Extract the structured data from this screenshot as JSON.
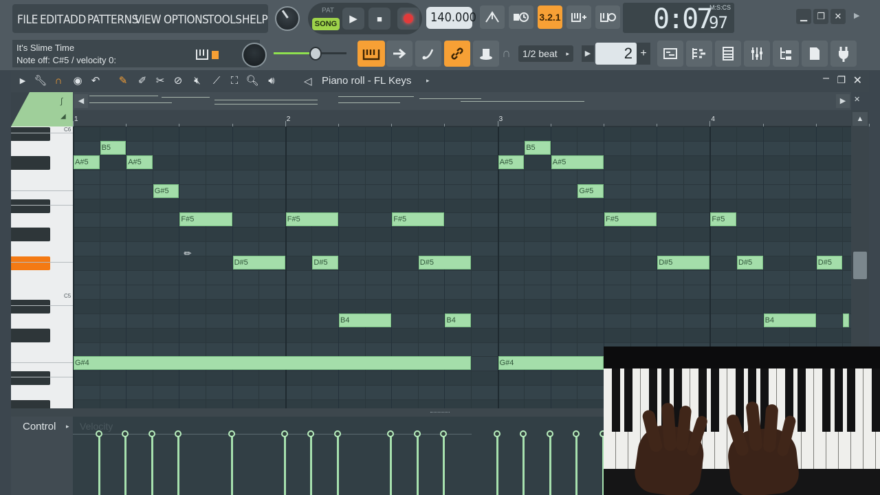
{
  "menu": {
    "items": [
      "FILE",
      "EDIT",
      "ADD",
      "PATTERNS",
      "VIEW",
      "OPTIONS",
      "TOOLS",
      "HELP"
    ]
  },
  "transport": {
    "pat_label": "PAT",
    "song_label": "SONG",
    "play_icon": "▶",
    "stop_icon": "■",
    "tempo": "140.000"
  },
  "time": {
    "main": "0:07",
    "cs": "97",
    "format": "M:S:CS"
  },
  "hint": {
    "title": "It's Slime Time",
    "text": "Note off: C#5 / velocity 0:"
  },
  "toolbar2": {
    "snap": "1/2 beat",
    "pattern_number": "2",
    "plus": "+"
  },
  "piano_roll": {
    "title": "Piano roll - FL Keys",
    "bar_numbers": [
      "1",
      "2",
      "3",
      "4"
    ],
    "octave_labels": [
      "C6",
      "C5"
    ],
    "control_label": "Control",
    "velocity_label": "Velocity"
  },
  "notes": [
    {
      "label": "B5",
      "row": 1,
      "start": 1,
      "len": 1
    },
    {
      "label": "A#5",
      "row": 2,
      "start": 0,
      "len": 1
    },
    {
      "label": "A#5",
      "row": 2,
      "start": 2,
      "len": 1
    },
    {
      "label": "G#5",
      "row": 4,
      "start": 3,
      "len": 1
    },
    {
      "label": "F#5",
      "row": 6,
      "start": 4,
      "len": 2
    },
    {
      "label": "F#5",
      "row": 6,
      "start": 8,
      "len": 2
    },
    {
      "label": "F#5",
      "row": 6,
      "start": 12,
      "len": 2
    },
    {
      "label": "D#5",
      "row": 9,
      "start": 6,
      "len": 2
    },
    {
      "label": "D#5",
      "row": 9,
      "start": 9,
      "len": 1
    },
    {
      "label": "D#5",
      "row": 9,
      "start": 13,
      "len": 2
    },
    {
      "label": "B4",
      "row": 13,
      "start": 10,
      "len": 2
    },
    {
      "label": "B4",
      "row": 13,
      "start": 14,
      "len": 1
    },
    {
      "label": "G#4",
      "row": 16,
      "start": 0,
      "len": 15
    },
    {
      "label": "B5",
      "row": 1,
      "start": 17,
      "len": 1
    },
    {
      "label": "A#5",
      "row": 2,
      "start": 16,
      "len": 1
    },
    {
      "label": "A#5",
      "row": 2,
      "start": 18,
      "len": 2
    },
    {
      "label": "G#5",
      "row": 4,
      "start": 19,
      "len": 1
    },
    {
      "label": "F#5",
      "row": 6,
      "start": 20,
      "len": 2
    },
    {
      "label": "F#5",
      "row": 6,
      "start": 24,
      "len": 1
    },
    {
      "label": "D#5",
      "row": 9,
      "start": 22,
      "len": 2
    },
    {
      "label": "D#5",
      "row": 9,
      "start": 25,
      "len": 1
    },
    {
      "label": "D#5",
      "row": 9,
      "start": 28,
      "len": 1
    },
    {
      "label": "B4",
      "row": 13,
      "start": 26,
      "len": 2
    },
    {
      "label": "",
      "row": 13,
      "start": 29,
      "len": 0.25
    },
    {
      "label": "G#4",
      "row": 16,
      "start": 16,
      "len": 4
    }
  ],
  "velocity_positions": [
    1,
    2,
    3,
    4,
    6,
    8,
    9,
    10,
    12,
    13,
    14,
    16,
    17,
    18,
    19,
    20
  ],
  "colors": {
    "note": "#a4deaa",
    "accent": "#f7a035",
    "song": "#9ed34a",
    "active_key": "#f47a13"
  }
}
